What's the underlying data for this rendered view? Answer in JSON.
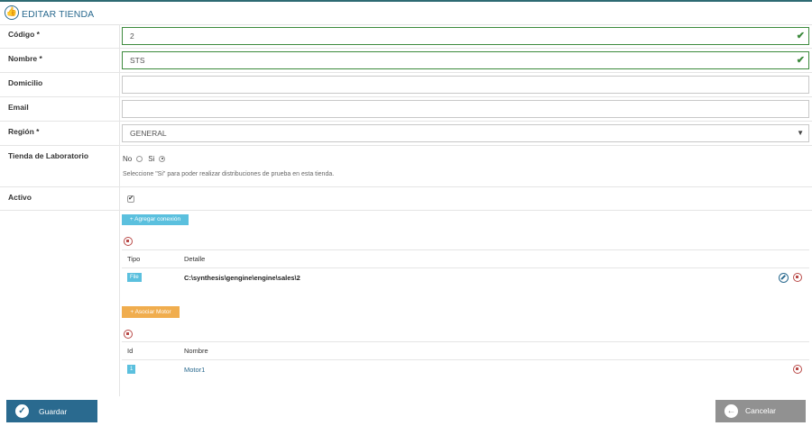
{
  "header": {
    "title": "EDITAR TIENDA",
    "icon": "thumbs-up-icon"
  },
  "form": {
    "codigo": {
      "label": "Código *",
      "value": "2"
    },
    "nombre": {
      "label": "Nombre *",
      "value": "STS"
    },
    "domicilio": {
      "label": "Domicilio",
      "value": ""
    },
    "email": {
      "label": "Email",
      "value": ""
    },
    "region": {
      "label": "Región *",
      "value": "GENERAL"
    },
    "laboratorio": {
      "label": "Tienda de Laboratorio",
      "no_label": "No",
      "si_label": "Si",
      "selected": "Si",
      "hint": "Seleccione \"Si\" para poder realizar distribuciones de prueba en esta tienda."
    },
    "activo": {
      "label": "Activo",
      "checked": true
    }
  },
  "connections": {
    "add_label": "+ Agregar conexión",
    "columns": [
      "Tipo",
      "Detalle"
    ],
    "rows": [
      {
        "tipo": "File",
        "detalle": "C:\\synthesis\\gengine\\engine\\sales\\2"
      }
    ]
  },
  "motors": {
    "add_label": "+ Asociar Motor",
    "columns": [
      "Id",
      "Nombre"
    ],
    "rows": [
      {
        "id": "1",
        "nombre": "Motor1"
      }
    ]
  },
  "footer": {
    "save_label": "Guardar",
    "cancel_label": "Cancelar"
  },
  "colors": {
    "primary": "#2a6a8f",
    "valid": "#3c8a3c",
    "info": "#5bc0de",
    "warning": "#f0ad4e",
    "danger": "#b94a48",
    "muted": "#919191"
  }
}
